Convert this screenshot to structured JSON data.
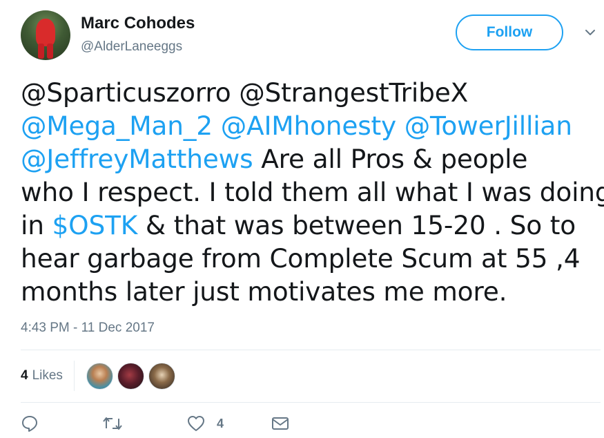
{
  "author": {
    "display_name": "Marc Cohodes",
    "handle": "@AlderLaneeggs"
  },
  "follow_button": {
    "label": "Follow"
  },
  "tweet": {
    "lines": [
      [
        {
          "t": "@Sparticuszorro @StrangestTribeX",
          "link": false
        }
      ],
      [
        {
          "t": "@Mega_Man_2 @AIMhonesty  @TowerJillian",
          "link": true
        }
      ],
      [
        {
          "t": "@JeffreyMatthews",
          "link": true
        },
        {
          "t": "  Are all Pros & people",
          "link": false
        }
      ],
      [
        {
          "t": "who I respect. I told them all what I was doing",
          "link": false
        }
      ],
      [
        {
          "t": "in ",
          "link": false
        },
        {
          "t": "$OSTK",
          "link": true
        },
        {
          "t": " & that was between 15-20 . So to",
          "link": false
        }
      ],
      [
        {
          "t": "hear garbage from Complete Scum at 55 ,4",
          "link": false
        }
      ],
      [
        {
          "t": "months later just motivates me more.",
          "link": false
        }
      ]
    ],
    "timestamp": "4:43 PM - 11 Dec 2017"
  },
  "stats": {
    "likes_count": "4",
    "likes_label": "Likes",
    "liker_avatars": [
      "liker-avatar-1",
      "liker-avatar-2",
      "liker-avatar-3"
    ]
  },
  "actions": {
    "reply_icon": "speech-bubble-icon",
    "retweet_icon": "retweet-arrows-icon",
    "like_icon": "heart-icon",
    "like_count": "4",
    "dm_icon": "envelope-icon"
  },
  "colors": {
    "accent": "#1da1f2",
    "text": "#14171a",
    "muted": "#657786",
    "border": "#e6ecf0"
  }
}
